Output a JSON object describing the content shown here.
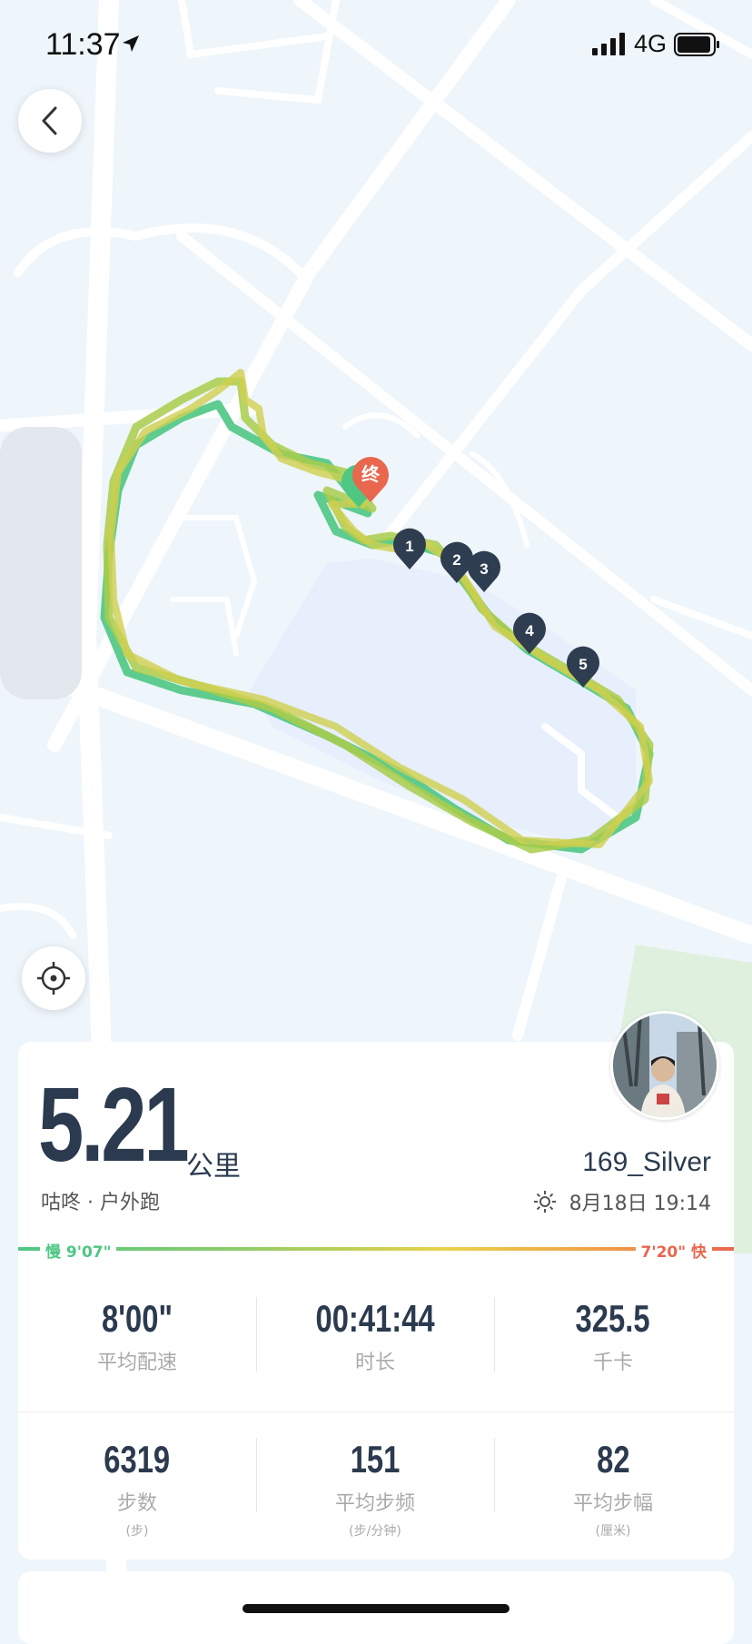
{
  "status_bar": {
    "time": "11:37",
    "network": "4G"
  },
  "map": {
    "end_marker_label": "终",
    "split_markers": [
      "1",
      "2",
      "3",
      "4",
      "5"
    ]
  },
  "summary": {
    "distance": "5.21",
    "distance_unit": "公里",
    "subtitle": "咕咚 · 户外跑",
    "username": "169_Silver",
    "datetime": "8月18日 19:14"
  },
  "pace_bar": {
    "slow_label": "慢 9'07\"",
    "fast_label": "7'20\" 快"
  },
  "stats": [
    {
      "value": "8'00\"",
      "label": "平均配速"
    },
    {
      "value": "00:41:44",
      "label": "时长"
    },
    {
      "value": "325.5",
      "label": "千卡"
    },
    {
      "value": "6319",
      "label": "步数",
      "sub": "(步)"
    },
    {
      "value": "151",
      "label": "平均步频",
      "sub": "(步/分钟)"
    },
    {
      "value": "82",
      "label": "平均步幅",
      "sub": "(厘米)"
    }
  ],
  "colors": {
    "route_green": "#4ec783",
    "route_yellow": "#c9cf4f",
    "end_marker": "#e8674e",
    "split_marker": "#2f3d50",
    "text_dark": "#2b3a4e"
  }
}
